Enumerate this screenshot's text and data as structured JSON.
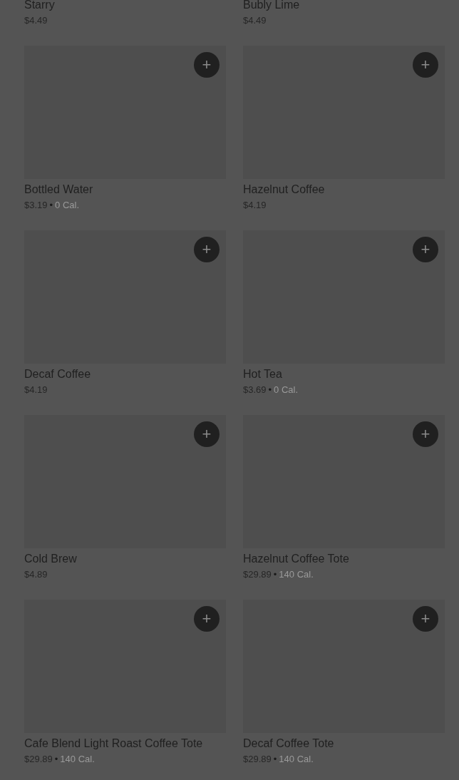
{
  "top_row": [
    {
      "name": "Starry",
      "price": "$4.49"
    },
    {
      "name": "Bubly Lime",
      "price": "$4.49"
    }
  ],
  "items": [
    {
      "name": "Bottled Water",
      "price": "$3.19",
      "separator": "•",
      "calories": "0 Cal.",
      "add_icon": "+"
    },
    {
      "name": "Hazelnut Coffee",
      "price": "$4.19",
      "add_icon": "+"
    },
    {
      "name": "Decaf Coffee",
      "price": "$4.19",
      "add_icon": "+"
    },
    {
      "name": "Hot Tea",
      "price": "$3.69",
      "separator": "•",
      "calories": "0 Cal.",
      "add_icon": "+"
    },
    {
      "name": "Cold Brew",
      "price": "$4.89",
      "add_icon": "+"
    },
    {
      "name": "Hazelnut Coffee Tote",
      "price": "$29.89",
      "separator": "•",
      "calories": "140 Cal.",
      "add_icon": "+"
    },
    {
      "name": "Cafe Blend Light Roast Coffee Tote",
      "price": "$29.89",
      "separator": "•",
      "calories": "140 Cal.",
      "add_icon": "+"
    },
    {
      "name": "Decaf Coffee Tote",
      "price": "$29.89",
      "separator": "•",
      "calories": "140 Cal.",
      "add_icon": "+"
    }
  ]
}
